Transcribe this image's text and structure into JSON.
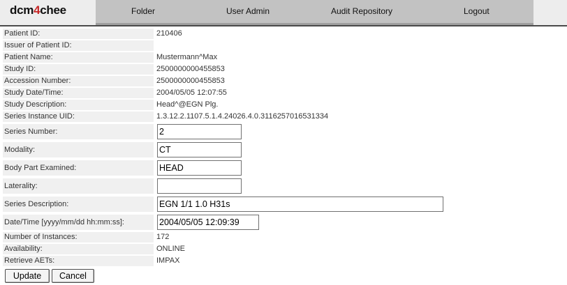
{
  "app": {
    "logo_prefix": "dcm",
    "logo_accent": "4",
    "logo_suffix": "chee"
  },
  "nav": {
    "folder": "Folder",
    "user_admin": "User Admin",
    "audit_repository": "Audit Repository",
    "logout": "Logout"
  },
  "fields": {
    "patient_id": {
      "label": "Patient ID:",
      "value": "210406"
    },
    "issuer_of_patient_id": {
      "label": "Issuer of Patient ID:",
      "value": ""
    },
    "patient_name": {
      "label": "Patient Name:",
      "value": "Mustermann^Max"
    },
    "study_id": {
      "label": "Study ID:",
      "value": "2500000000455853"
    },
    "accession_number": {
      "label": "Accession Number:",
      "value": "2500000000455853"
    },
    "study_datetime": {
      "label": "Study Date/Time:",
      "value": "2004/05/05 12:07:55"
    },
    "study_description": {
      "label": "Study Description:",
      "value": "Head^@EGN Plg."
    },
    "series_instance_uid": {
      "label": "Series Instance UID:",
      "value": "1.3.12.2.1107.5.1.4.24026.4.0.3116257016531334"
    },
    "series_number": {
      "label": "Series Number:",
      "value": "2"
    },
    "modality": {
      "label": "Modality:",
      "value": "CT"
    },
    "body_part_examined": {
      "label": "Body Part Examined:",
      "value": "HEAD"
    },
    "laterality": {
      "label": "Laterality:",
      "value": ""
    },
    "series_description": {
      "label": "Series Description:",
      "value": "EGN 1/1 1.0 H31s"
    },
    "series_datetime": {
      "label": "Date/Time [yyyy/mm/dd hh:mm:ss]:",
      "value": "2004/05/05 12:09:39"
    },
    "number_of_instances": {
      "label": "Number of Instances:",
      "value": "172"
    },
    "availability": {
      "label": "Availability:",
      "value": "ONLINE"
    },
    "retrieve_aets": {
      "label": "Retrieve AETs:",
      "value": "IMPAX"
    }
  },
  "buttons": {
    "update": "Update",
    "cancel": "Cancel"
  },
  "colors": {
    "nav_background": "#c2c2c2",
    "label_background": "#f0f0f0",
    "logo_accent": "#c62828"
  }
}
